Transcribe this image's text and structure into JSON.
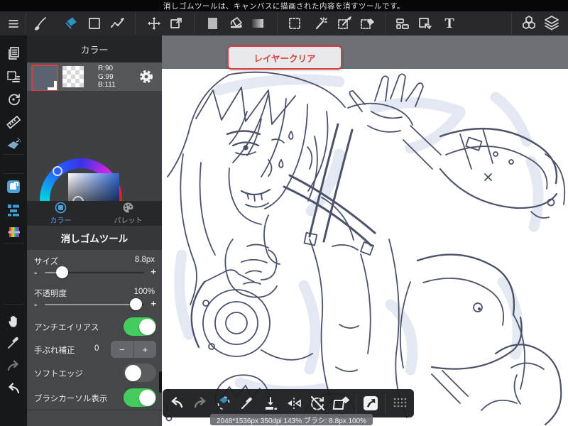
{
  "notification_bar": {
    "text": "消しゴムツールは、キャンバスに描画された内容を消すツールです。"
  },
  "top_toolbar": {
    "active_tool": "eraser",
    "text_tool_glyph": "T",
    "tools": [
      "menu",
      "brush",
      "eraser",
      "shape-rect",
      "polyline-pen",
      "move",
      "transform",
      "color-swatch",
      "fill-bucket",
      "gradient",
      "select-rect",
      "magic-wand",
      "select-pen",
      "select-eraser",
      "split-view",
      "select-move",
      "text",
      "material-cubes",
      "layers"
    ]
  },
  "sidebar": {
    "tools": [
      "pages",
      "select-detail",
      "rotate-reset",
      "ruler",
      "airbrush",
      "material",
      "layer-list",
      "rainbow-palette",
      "hand",
      "eyedropper",
      "redo",
      "undo"
    ]
  },
  "color_panel": {
    "title": "カラー",
    "rgb": {
      "r": "R:90",
      "g": "G:99",
      "b": "B:111"
    },
    "tabs": [
      {
        "label": "カラー",
        "active": true
      },
      {
        "label": "パレット",
        "active": false
      }
    ],
    "tool_title": "消しゴムツール",
    "size": {
      "label": "サイズ",
      "value": "8.8px"
    },
    "opacity": {
      "label": "不透明度",
      "value": "100%"
    },
    "antialias": {
      "label": "アンチエイリアス",
      "on": true
    },
    "stabilize": {
      "label": "手ぶれ補正",
      "value": "0",
      "minus": "−",
      "plus": "+"
    },
    "softedge": {
      "label": "ソフトエッジ",
      "on": false
    },
    "brush_cursor": {
      "label": "ブラシカーソル表示",
      "on": true
    },
    "slider_minus": "-",
    "slider_plus": "+"
  },
  "canvas": {
    "clear_button_label": "レイヤークリア",
    "status_text": "2048*1536px 350dpi 143% ブラシ: 8.8px 100%"
  },
  "colors": {
    "accent_blue": "#2f8fc0",
    "tab_blue": "#4da0d8",
    "toggle_green": "#43cd5c",
    "alert_red": "#d6403d",
    "foreground_swatch": "#5a636f",
    "sketch_line": "#4b5269",
    "sketch_shade": "#dfe5f0"
  }
}
